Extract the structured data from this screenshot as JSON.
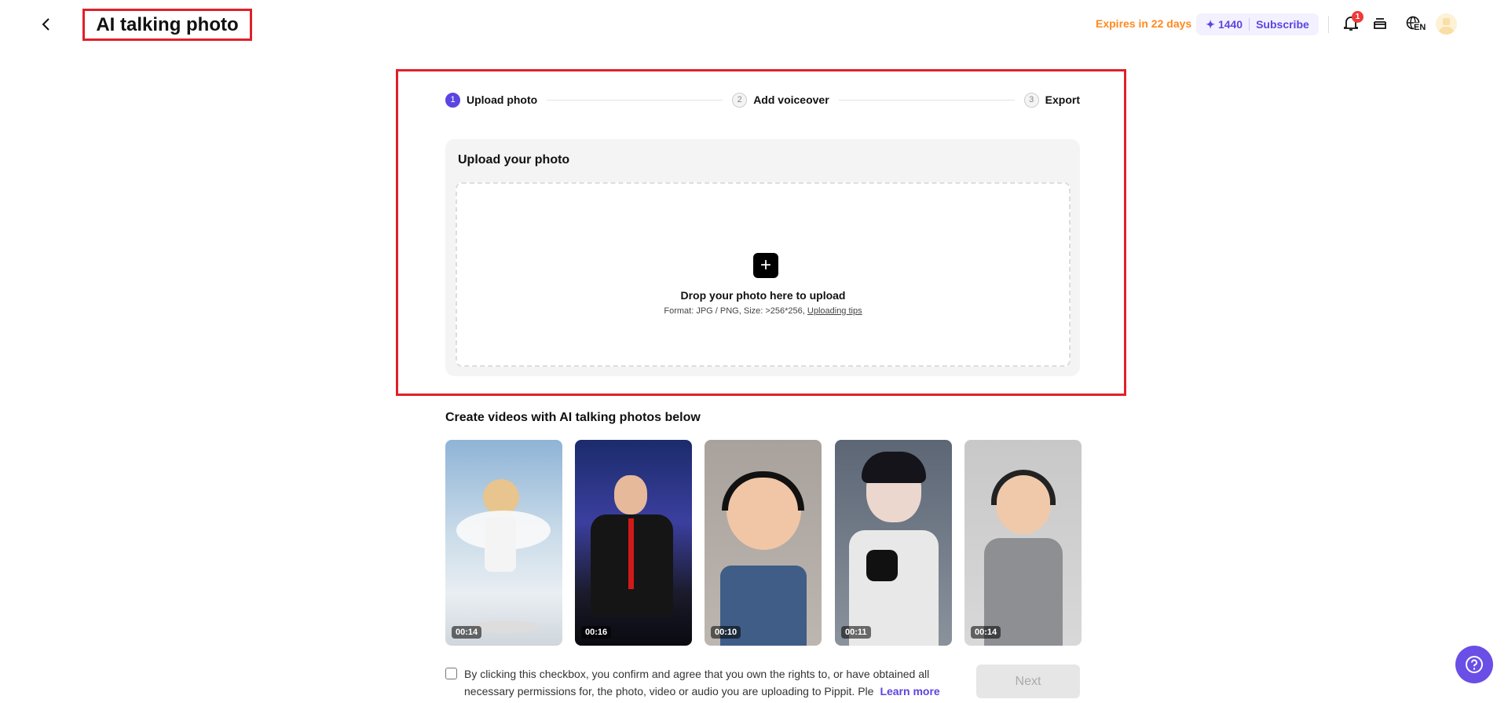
{
  "header": {
    "title": "AI talking photo",
    "expires": "Expires in 22 days",
    "credits": "1440",
    "subscribe": "Subscribe",
    "notification_count": "1",
    "language": "EN"
  },
  "steps": [
    {
      "num": "1",
      "label": "Upload photo"
    },
    {
      "num": "2",
      "label": "Add voiceover"
    },
    {
      "num": "3",
      "label": "Export"
    }
  ],
  "upload": {
    "title": "Upload your photo",
    "drop_text": "Drop your photo here to upload",
    "format_text": "Format: JPG / PNG, Size: >256*256,",
    "tips_link": "Uploading tips"
  },
  "examples": {
    "title": "Create videos with AI talking photos below",
    "items": [
      {
        "duration": "00:14",
        "subject": "angel-toddler"
      },
      {
        "duration": "00:16",
        "subject": "dj-man"
      },
      {
        "duration": "00:10",
        "subject": "baby-headphones"
      },
      {
        "duration": "00:11",
        "subject": "anime-man"
      },
      {
        "duration": "00:14",
        "subject": "baby-singer"
      }
    ]
  },
  "footer": {
    "consent": "By clicking this checkbox, you confirm and agree that you own the rights to, or have obtained all necessary permissions for, the photo, video or audio you are uploading to Pippit. Ple",
    "learn_more": "Learn more",
    "next": "Next"
  },
  "colors": {
    "accent": "#5b45e0",
    "expires": "#ff8a1f",
    "highlight": "#e0202a"
  }
}
